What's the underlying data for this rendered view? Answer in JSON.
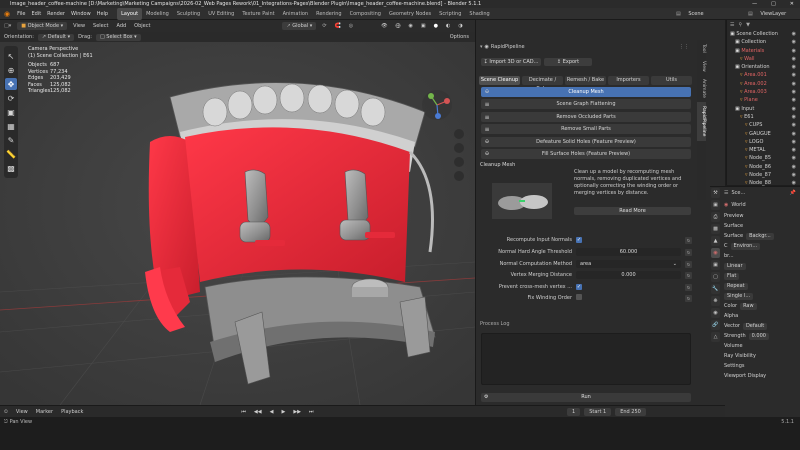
{
  "window": {
    "title": "Image_header_coffee-machine [D:\\Marketing\\Marketing Campaigns\\2026-02_Web Pages Rework\\01_Integrations-Pages\\Blender Plugin\\Image_header_coffee-machine.blend] - Blender 5.1.1"
  },
  "menubar": {
    "menus": [
      "File",
      "Edit",
      "Render",
      "Window",
      "Help"
    ],
    "workspaces": [
      "Layout",
      "Modeling",
      "Sculpting",
      "UV Editing",
      "Texture Paint",
      "Animation",
      "Rendering",
      "Compositing",
      "Geometry Nodes",
      "Scripting",
      "Shading"
    ],
    "active_workspace": "Layout",
    "scene_label": "Scene",
    "view_layer_label": "ViewLayer"
  },
  "viewport_header": {
    "mode": "Object Mode",
    "menus": [
      "View",
      "Select",
      "Add",
      "Object"
    ],
    "transform": "Global",
    "orientation_label": "Orientation:",
    "orientation_value": "Default",
    "drag_label": "Drag:",
    "drag_value": "Select Box",
    "options": "Options"
  },
  "viewport_overlay": {
    "camera": "Camera Perspective",
    "collection": "(1) Scene Collection | E61",
    "stats": [
      {
        "label": "Objects",
        "value": "687"
      },
      {
        "label": "Vertices",
        "value": "77,234"
      },
      {
        "label": "Edges",
        "value": "203,429"
      },
      {
        "label": "Faces",
        "value": "125,082"
      },
      {
        "label": "Triangles",
        "value": "125,082"
      }
    ]
  },
  "plugin": {
    "name": "RapidPipeline",
    "import_button": "Import 3D or CAD...",
    "export_button": "Export",
    "tabs": [
      "Scene Cleanup",
      "Decimate / Bake",
      "Remesh / Bake",
      "Importers",
      "Utils"
    ],
    "active_tab": "Scene Cleanup",
    "operations": [
      {
        "label": "Cleanup Mesh",
        "icon": "cleanup-icon",
        "active": true
      },
      {
        "label": "Scene Graph Flattening",
        "icon": "flatten-icon",
        "active": false
      },
      {
        "label": "Remove Occluded Parts",
        "icon": "occluded-icon",
        "active": false
      },
      {
        "label": "Remove Small Parts",
        "icon": "small-parts-icon",
        "active": false
      },
      {
        "label": "Defeature Solid Holes (Feature Preview)",
        "icon": "holes-icon",
        "active": false
      },
      {
        "label": "Fill Surface Holes (Feature Preview)",
        "icon": "fill-icon",
        "active": false
      }
    ],
    "section_title": "Cleanup Mesh",
    "description": "Clean up a model by recomputing mesh normals, removing duplicated vertices and optionally correcting the winding order or merging vertices by distance.",
    "read_more": "Read More",
    "settings": [
      {
        "label": "Recompute Input Normals",
        "type": "checkbox",
        "checked": true
      },
      {
        "label": "Normal Hard Angle Threshold",
        "type": "number",
        "value": "60.000"
      },
      {
        "label": "Normal Computation Method",
        "type": "select",
        "value": "area"
      },
      {
        "label": "Vertex Merging Distance",
        "type": "number",
        "value": "0.000"
      },
      {
        "label": "Prevent cross-mesh vertex ...",
        "type": "checkbox",
        "checked": true
      },
      {
        "label": "Fix Winding Order",
        "type": "checkbox",
        "checked": false
      }
    ],
    "process_log": "Process Log",
    "run_button": "Run"
  },
  "side_tabs": [
    "Tool",
    "View",
    "Animate",
    "RapidPipeline"
  ],
  "outliner": {
    "rows": [
      {
        "label": "Scene Collection",
        "indent": 0,
        "red": false
      },
      {
        "label": "Collection",
        "indent": 1,
        "red": false
      },
      {
        "label": "Materials",
        "indent": 1,
        "red": true
      },
      {
        "label": "Wall",
        "indent": 2,
        "red": true
      },
      {
        "label": "Orientation",
        "indent": 1,
        "red": false
      },
      {
        "label": "Area.001",
        "indent": 2,
        "red": true
      },
      {
        "label": "Area.002",
        "indent": 2,
        "red": true
      },
      {
        "label": "Area.003",
        "indent": 2,
        "red": true
      },
      {
        "label": "Plane",
        "indent": 2,
        "red": true
      },
      {
        "label": "Input",
        "indent": 1,
        "red": false
      },
      {
        "label": "E61",
        "indent": 2,
        "red": false
      },
      {
        "label": "CUPS",
        "indent": 3,
        "red": false
      },
      {
        "label": "GAUGUE",
        "indent": 3,
        "red": false
      },
      {
        "label": "LOGO",
        "indent": 3,
        "red": false
      },
      {
        "label": "METAL",
        "indent": 3,
        "red": false
      },
      {
        "label": "Node_85",
        "indent": 3,
        "red": false
      },
      {
        "label": "Node_86",
        "indent": 3,
        "red": false
      },
      {
        "label": "Node_87",
        "indent": 3,
        "red": false
      },
      {
        "label": "Node_88",
        "indent": 3,
        "red": false
      }
    ]
  },
  "properties": {
    "breadcrumb": "Sce...",
    "world_label": "World",
    "rows": [
      {
        "label": "Preview",
        "value": ""
      },
      {
        "label": "Surface",
        "value": ""
      },
      {
        "label": "Surface",
        "value": "Backgr..."
      },
      {
        "label": "C",
        "value": "Environ..."
      },
      {
        "label": "br...",
        "value": ""
      },
      {
        "label": "",
        "value": "Linear"
      },
      {
        "label": "",
        "value": "Flat"
      },
      {
        "label": "",
        "value": "Repeat"
      },
      {
        "label": "",
        "value": "Single I..."
      },
      {
        "label": "Color",
        "value": "Raw"
      },
      {
        "label": "Alpha",
        "value": ""
      },
      {
        "label": "Vector",
        "value": "Default"
      },
      {
        "label": "Strength",
        "value": "0.000"
      },
      {
        "label": "Volume",
        "value": ""
      },
      {
        "label": "Ray Visibility",
        "value": ""
      },
      {
        "label": "Settings",
        "value": ""
      },
      {
        "label": "Viewport Display",
        "value": ""
      }
    ]
  },
  "timeline": {
    "menus": [
      "View",
      "Marker",
      "Playback"
    ],
    "current_frame": "1",
    "start_label": "Start",
    "start": "1",
    "end_label": "End",
    "end": "250"
  },
  "status": {
    "left": "Pan View",
    "version": "5.1.1"
  }
}
